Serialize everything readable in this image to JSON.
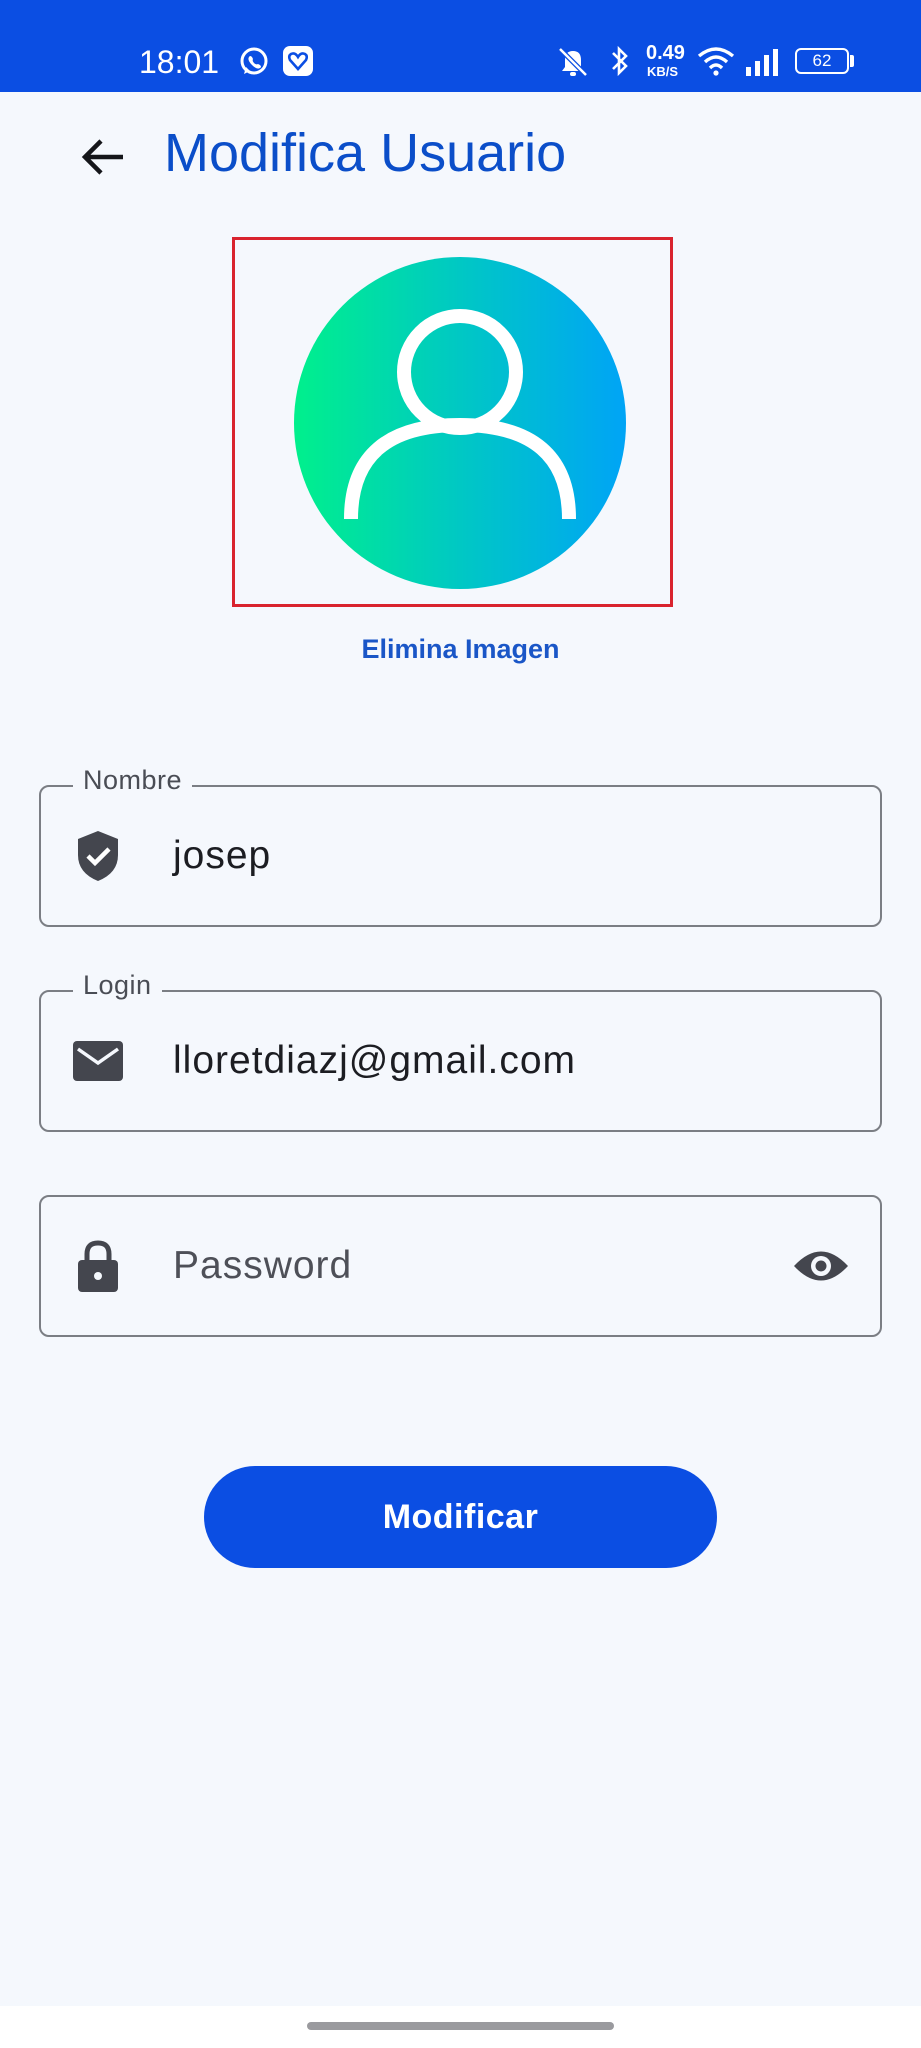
{
  "status_bar": {
    "time": "18:01",
    "icons": [
      "whatsapp-icon",
      "app-notification-icon",
      "mute-icon",
      "bluetooth-icon",
      "wifi-icon",
      "signal-icon",
      "battery-icon"
    ],
    "net_speed_value": "0.49",
    "net_speed_unit": "KB/S",
    "battery": "62"
  },
  "app_bar": {
    "title": "Modifica Usuario",
    "back_icon": "arrow-left-icon"
  },
  "avatar": {
    "icon": "user-icon",
    "delete_label": "Elimina Imagen"
  },
  "form": {
    "nombre": {
      "label": "Nombre",
      "value": "josep",
      "icon": "shield-check-icon"
    },
    "login": {
      "label": "Login",
      "value": "lloretdiazj@gmail.com",
      "icon": "mail-icon"
    },
    "password": {
      "placeholder": "Password",
      "icon": "lock-icon",
      "toggle_icon": "eye-icon"
    }
  },
  "submit": {
    "label": "Modificar"
  },
  "colors": {
    "primary": "#0b4ee3",
    "title": "#0b4ec9",
    "link": "#1a56c7",
    "background": "#f5f8fd",
    "frame": "#d9232e"
  }
}
